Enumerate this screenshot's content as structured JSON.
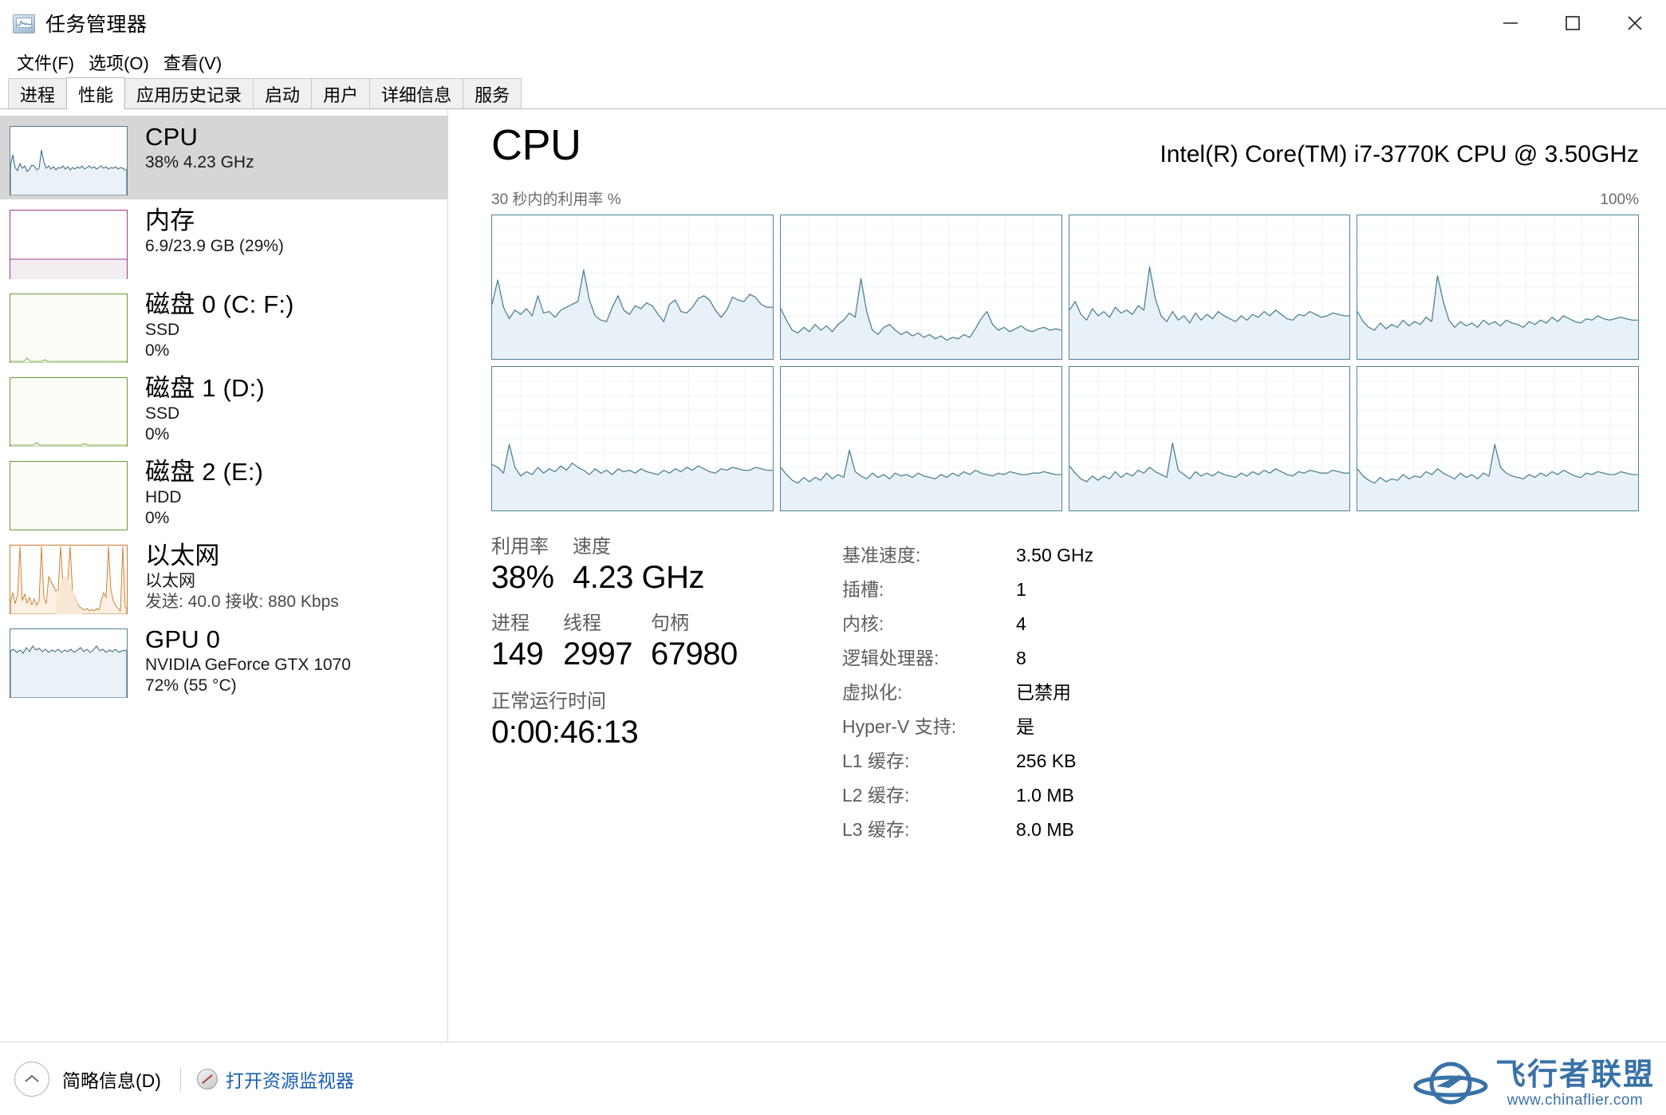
{
  "window": {
    "title": "任务管理器",
    "icon": "task-manager-icon",
    "minimize_label": "–",
    "maximize_label": "□",
    "close_label": "×"
  },
  "menu": {
    "items": [
      {
        "label": "文件(F)"
      },
      {
        "label": "选项(O)"
      },
      {
        "label": "查看(V)"
      }
    ]
  },
  "tabs": [
    {
      "label": "进程",
      "active": false
    },
    {
      "label": "性能",
      "active": true
    },
    {
      "label": "应用历史记录",
      "active": false
    },
    {
      "label": "启动",
      "active": false
    },
    {
      "label": "用户",
      "active": false
    },
    {
      "label": "详细信息",
      "active": false
    },
    {
      "label": "服务",
      "active": false
    }
  ],
  "sidebar": {
    "items": [
      {
        "name": "cpu",
        "title": "CPU",
        "sub1": "38%  4.23 GHz",
        "sub2": "",
        "sub3": "",
        "selected": true,
        "color": "#4f8294",
        "fill": "#eaf2f8"
      },
      {
        "name": "memory",
        "title": "内存",
        "sub1": "6.9/23.9 GB (29%)",
        "sub2": "",
        "sub3": "",
        "selected": false,
        "color": "#a03a8f",
        "fill": "#f4e9f2"
      },
      {
        "name": "disk-0",
        "title": "磁盘 0 (C: F:)",
        "sub1": "SSD",
        "sub2": "0%",
        "sub3": "",
        "selected": false,
        "color": "#6a9b3a",
        "fill": "#f3f8ec"
      },
      {
        "name": "disk-1",
        "title": "磁盘 1 (D:)",
        "sub1": "SSD",
        "sub2": "0%",
        "sub3": "",
        "selected": false,
        "color": "#6a9b3a",
        "fill": "#f3f8ec"
      },
      {
        "name": "disk-2",
        "title": "磁盘 2 (E:)",
        "sub1": "HDD",
        "sub2": "0%",
        "sub3": "",
        "selected": false,
        "color": "#6a9b3a",
        "fill": "#f3f8ec"
      },
      {
        "name": "ethernet",
        "title": "以太网",
        "sub1": "以太网",
        "sub2": "发送: 40.0  接收: 880 Kbps",
        "sub3": "",
        "selected": false,
        "color": "#c87a2a",
        "fill": "#fbf1e4"
      },
      {
        "name": "gpu-0",
        "title": "GPU 0",
        "sub1": "NVIDIA GeForce GTX 1070",
        "sub2": "72% (55 °C)",
        "sub3": "",
        "selected": false,
        "color": "#4f8294",
        "fill": "#eaf2f8"
      }
    ]
  },
  "main": {
    "title": "CPU",
    "cpu_name": "Intel(R) Core(TM) i7-3770K CPU @ 3.50GHz",
    "graph_caption_left": "30 秒内的利用率 %",
    "graph_caption_right": "100%",
    "graph_color": "#4f8294",
    "graph_fill": "#e9f1f8",
    "graph_grid_color": "#cfe3ef",
    "stats": [
      {
        "label": "利用率",
        "value": "38%"
      },
      {
        "label": "速度",
        "value": "4.23 GHz"
      },
      {
        "label": "进程",
        "value": "149"
      },
      {
        "label": "线程",
        "value": "2997"
      },
      {
        "label": "句柄",
        "value": "67980"
      },
      {
        "label": "正常运行时间",
        "value": "0:00:46:13"
      }
    ],
    "details": [
      {
        "key": "基准速度:",
        "value": "3.50 GHz"
      },
      {
        "key": "插槽:",
        "value": "1"
      },
      {
        "key": "内核:",
        "value": "4"
      },
      {
        "key": "逻辑处理器:",
        "value": "8"
      },
      {
        "key": "虚拟化:",
        "value": "已禁用"
      },
      {
        "key": "Hyper-V 支持:",
        "value": "是"
      },
      {
        "key": "L1 缓存:",
        "value": "256 KB"
      },
      {
        "key": "L2 缓存:",
        "value": "1.0 MB"
      },
      {
        "key": "L3 缓存:",
        "value": "8.0 MB"
      }
    ]
  },
  "statusbar": {
    "collapse_label": "简略信息(D)",
    "resource_monitor_label": "打开资源监视器",
    "link_color": "#1a5fb4"
  },
  "watermark": {
    "name": "飞行者联盟",
    "url": "www.chinaflier.com",
    "color": "#3a72a8"
  },
  "chart_data": {
    "type": "line",
    "title": "30 秒内的利用率 %",
    "ylabel": "%",
    "ylim": [
      0,
      100
    ],
    "xlim": [
      0,
      30
    ],
    "grid": true,
    "legend": "none",
    "series": [
      {
        "name": "CPU 0",
        "values": [
          38,
          55,
          36,
          28,
          34,
          31,
          35,
          30,
          44,
          32,
          33,
          29,
          34,
          36,
          38,
          40,
          62,
          41,
          30,
          27,
          26,
          36,
          44,
          34,
          31,
          37,
          35,
          39,
          37,
          31,
          26,
          38,
          41,
          33,
          32,
          36,
          42,
          44,
          41,
          34,
          29,
          34,
          43,
          41,
          40,
          45,
          43,
          38,
          36,
          36
        ]
      },
      {
        "name": "CPU 1",
        "values": [
          35,
          27,
          20,
          18,
          22,
          19,
          24,
          20,
          23,
          19,
          24,
          27,
          32,
          29,
          56,
          33,
          20,
          17,
          22,
          24,
          20,
          17,
          19,
          16,
          18,
          15,
          17,
          14,
          16,
          13,
          15,
          14,
          17,
          15,
          21,
          28,
          33,
          24,
          20,
          22,
          19,
          21,
          23,
          20,
          19,
          21,
          22,
          20,
          21,
          20
        ]
      },
      {
        "name": "CPU 2",
        "values": [
          34,
          40,
          31,
          27,
          35,
          30,
          33,
          29,
          36,
          32,
          34,
          31,
          37,
          34,
          64,
          42,
          30,
          26,
          33,
          27,
          30,
          25,
          32,
          27,
          31,
          28,
          33,
          30,
          28,
          26,
          30,
          27,
          31,
          29,
          33,
          30,
          34,
          31,
          28,
          27,
          31,
          30,
          33,
          31,
          29,
          30,
          32,
          31,
          30,
          30
        ]
      },
      {
        "name": "CPU 3",
        "values": [
          33,
          26,
          22,
          20,
          25,
          21,
          24,
          22,
          27,
          23,
          26,
          24,
          29,
          26,
          58,
          40,
          27,
          22,
          26,
          23,
          25,
          22,
          27,
          24,
          26,
          23,
          27,
          25,
          24,
          22,
          26,
          24,
          27,
          25,
          29,
          26,
          30,
          28,
          26,
          25,
          28,
          27,
          30,
          28,
          27,
          28,
          29,
          28,
          27,
          27
        ]
      },
      {
        "name": "CPU 4",
        "values": [
          32,
          30,
          26,
          46,
          30,
          24,
          27,
          25,
          30,
          26,
          29,
          27,
          31,
          28,
          33,
          30,
          28,
          25,
          29,
          26,
          28,
          25,
          29,
          27,
          28,
          26,
          29,
          27,
          26,
          25,
          28,
          26,
          29,
          27,
          30,
          28,
          31,
          29,
          27,
          26,
          29,
          28,
          30,
          29,
          28,
          28,
          30,
          29,
          28,
          28
        ]
      },
      {
        "name": "CPU 5",
        "values": [
          30,
          25,
          21,
          19,
          23,
          20,
          23,
          21,
          26,
          22,
          25,
          23,
          42,
          27,
          24,
          22,
          26,
          23,
          25,
          22,
          26,
          24,
          25,
          23,
          26,
          24,
          23,
          22,
          25,
          23,
          26,
          24,
          27,
          25,
          28,
          26,
          25,
          24,
          26,
          25,
          27,
          26,
          25,
          25,
          26,
          26,
          27,
          26,
          25,
          25
        ]
      },
      {
        "name": "CPU 6",
        "values": [
          31,
          26,
          22,
          20,
          24,
          21,
          24,
          22,
          27,
          23,
          26,
          24,
          28,
          26,
          30,
          27,
          25,
          23,
          47,
          28,
          25,
          22,
          27,
          24,
          26,
          24,
          27,
          25,
          24,
          23,
          26,
          24,
          27,
          25,
          28,
          26,
          29,
          27,
          25,
          24,
          27,
          26,
          28,
          27,
          26,
          26,
          28,
          27,
          26,
          26
        ]
      },
      {
        "name": "CPU 7",
        "values": [
          29,
          24,
          21,
          19,
          23,
          20,
          22,
          21,
          25,
          22,
          24,
          23,
          27,
          25,
          29,
          26,
          24,
          22,
          26,
          23,
          25,
          22,
          26,
          24,
          46,
          30,
          26,
          24,
          23,
          22,
          25,
          23,
          26,
          24,
          27,
          25,
          28,
          26,
          24,
          23,
          26,
          25,
          27,
          26,
          25,
          25,
          27,
          26,
          25,
          25
        ]
      }
    ]
  }
}
